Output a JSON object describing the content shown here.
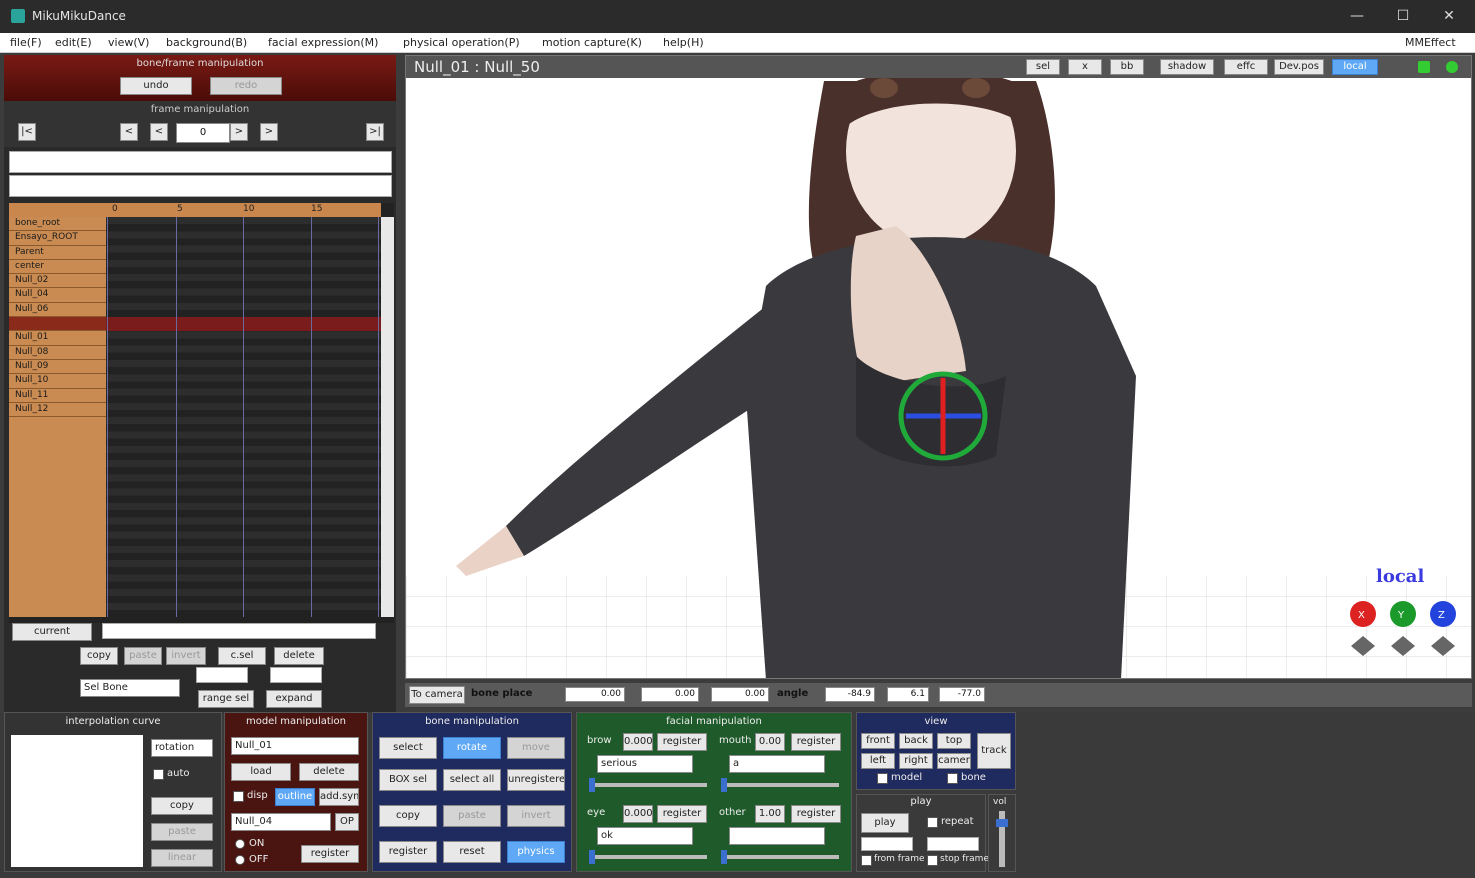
{
  "window": {
    "title": "MikuMikuDance",
    "minimize": "—",
    "maximize": "☐",
    "close": "✕"
  },
  "menu": [
    "file(F)",
    "edit(E)",
    "view(V)",
    "background(B)",
    "facial expression(M)",
    "physical operation(P)",
    "motion capture(K)",
    "help(H)"
  ],
  "menu_right": "MMEffect",
  "bone_frame": {
    "header": "bone/frame manipulation",
    "undo": "undo",
    "redo": "redo",
    "frame_header": "frame manipulation",
    "frame_value": "0",
    "nav": [
      "|<",
      "<",
      "<",
      ">",
      ">",
      ">|"
    ]
  },
  "timeline": {
    "ruler": [
      "0",
      "5",
      "10",
      "15"
    ],
    "rows": [
      "bone_root",
      "Ensayo_ROOT",
      "Parent",
      "center",
      "Null_02",
      "Null_04",
      "Null_06",
      "",
      "Null_01",
      "Null_08",
      "Null_09",
      "Null_10",
      "Null_11",
      "Null_12"
    ]
  },
  "left_buttons": {
    "current": "current",
    "copy": "copy",
    "paste": "paste",
    "paste_inv": "invert",
    "c_sel": "c.sel",
    "delete": "delete",
    "bone_select": "Sel Bone",
    "range_sel": "range sel",
    "expand": "expand"
  },
  "viewport": {
    "title": "Null_01 : Null_50",
    "top_buttons": [
      "sel",
      "x",
      "bb",
      "shadow",
      "effc",
      "Dev.pos",
      "local"
    ],
    "local_label": "local",
    "axes": [
      "X",
      "Y",
      "Z"
    ]
  },
  "coords": {
    "to_camera": "To camera",
    "bone_place": "bone place",
    "x": "0.00",
    "y": "0.00",
    "z": "0.00",
    "angle": "angle",
    "ax": "-84.9",
    "ay": "6.1",
    "az": "-77.0"
  },
  "interp": {
    "header": "interpolation curve",
    "select": "rotation",
    "auto": "auto",
    "copy": "copy",
    "paste": "paste",
    "linear": "linear"
  },
  "model": {
    "header": "model manipulation",
    "model_select": "Null_01",
    "load": "load",
    "delete": "delete",
    "disp": "disp",
    "blue_btn": "outline",
    "add": "add.symm",
    "child_select": "Null_04",
    "op": "OP",
    "on": "ON",
    "off": "OFF",
    "register": "register"
  },
  "bone": {
    "header": "bone manipulation",
    "select": "select",
    "rotate": "rotate",
    "move": "move",
    "box_sel": "BOX sel",
    "select_all": "select all",
    "unregistered": "unregistered",
    "copy": "copy",
    "paste": "paste",
    "invert": "invert",
    "register": "register",
    "reset": "reset",
    "physics": "physics"
  },
  "facial": {
    "header": "facial manipulation",
    "brow": "brow",
    "brow_val": "0.000",
    "register": "register",
    "mouth": "mouth",
    "mouth_val": "0.00",
    "eye": "eye",
    "eye_val": "0.000",
    "other": "other",
    "other_val": "1.00",
    "sel_brow": "serious",
    "sel_mouth": "a",
    "sel_eye": "ok",
    "sel_other": ""
  },
  "view": {
    "header": "view",
    "front": "front",
    "back": "back",
    "top": "top",
    "left": "left",
    "right": "right",
    "camer": "camer",
    "track": "track",
    "model": "model",
    "bone": "bone"
  },
  "play": {
    "header": "play",
    "play": "play",
    "repeat": "repeat",
    "from_frame": "from frame",
    "stop_frame": "stop frame",
    "vol": "vol"
  },
  "colors": {
    "accent": "#5fa8f5",
    "local": "#3a3ae0",
    "bone_header": "#7a1a14",
    "facial": "#1e5a2a",
    "bone_manip": "#1f2a5e"
  }
}
